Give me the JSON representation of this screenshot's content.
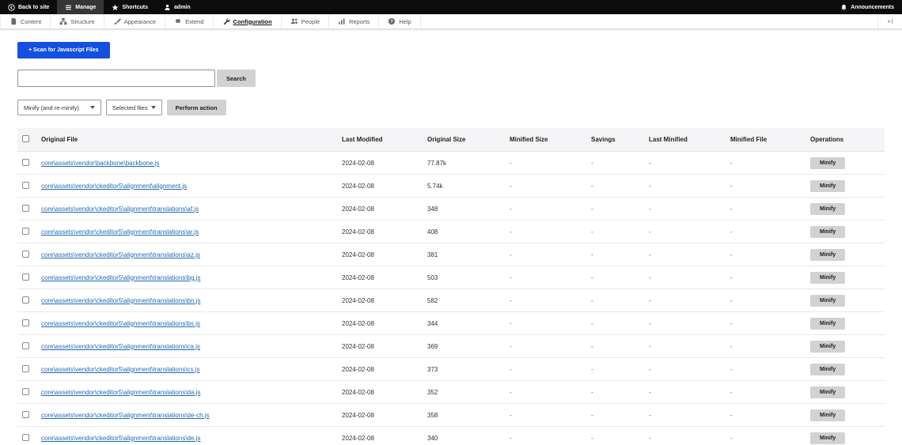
{
  "admin_bar": {
    "back_to_site": "Back to site",
    "manage": "Manage",
    "shortcuts": "Shortcuts",
    "user": "admin",
    "announcements": "Announcements"
  },
  "menu_bar": {
    "active": "Configuration",
    "items": [
      {
        "label": "Content",
        "icon": "file-icon"
      },
      {
        "label": "Structure",
        "icon": "sitemap-icon"
      },
      {
        "label": "Appearance",
        "icon": "brush-icon"
      },
      {
        "label": "Extend",
        "icon": "puzzle-icon"
      },
      {
        "label": "Configuration",
        "icon": "wrench-icon"
      },
      {
        "label": "People",
        "icon": "people-icon"
      },
      {
        "label": "Reports",
        "icon": "barchart-icon"
      },
      {
        "label": "Help",
        "icon": "help-icon"
      }
    ]
  },
  "actions": {
    "scan_button": "+ Scan for Javascript Files",
    "search_placeholder": "",
    "search_value": "",
    "search_button": "Search",
    "action_select": "Minify (and re-minify)",
    "files_dropdown": "Selected files",
    "perform_button": "Perform action"
  },
  "table": {
    "headers": [
      "Original File",
      "Last Modified",
      "Original Size",
      "Minified Size",
      "Savings",
      "Last Minified",
      "Minified File",
      "Operations"
    ],
    "operation_label": "Minify",
    "rows": [
      {
        "file": "core\\assets\\vendor\\backbone\\backbone.js",
        "last_modified": "2024-02-08",
        "original_size": "77.87k",
        "minified_size": "-",
        "savings": "-",
        "last_minified": "-",
        "minified_file": "-"
      },
      {
        "file": "core\\assets\\vendor\\ckeditor5\\alignment\\alignment.js",
        "last_modified": "2024-02-08",
        "original_size": "5.74k",
        "minified_size": "-",
        "savings": "-",
        "last_minified": "-",
        "minified_file": "-"
      },
      {
        "file": "core\\assets\\vendor\\ckeditor5\\alignment\\translations\\af.js",
        "last_modified": "2024-02-08",
        "original_size": "348",
        "minified_size": "-",
        "savings": "-",
        "last_minified": "-",
        "minified_file": "-"
      },
      {
        "file": "core\\assets\\vendor\\ckeditor5\\alignment\\translations\\ar.js",
        "last_modified": "2024-02-08",
        "original_size": "408",
        "minified_size": "-",
        "savings": "-",
        "last_minified": "-",
        "minified_file": "-"
      },
      {
        "file": "core\\assets\\vendor\\ckeditor5\\alignment\\translations\\az.js",
        "last_modified": "2024-02-08",
        "original_size": "381",
        "minified_size": "-",
        "savings": "-",
        "last_minified": "-",
        "minified_file": "-"
      },
      {
        "file": "core\\assets\\vendor\\ckeditor5\\alignment\\translations\\bg.js",
        "last_modified": "2024-02-08",
        "original_size": "503",
        "minified_size": "-",
        "savings": "-",
        "last_minified": "-",
        "minified_file": "-"
      },
      {
        "file": "core\\assets\\vendor\\ckeditor5\\alignment\\translations\\bn.js",
        "last_modified": "2024-02-08",
        "original_size": "582",
        "minified_size": "-",
        "savings": "-",
        "last_minified": "-",
        "minified_file": "-"
      },
      {
        "file": "core\\assets\\vendor\\ckeditor5\\alignment\\translations\\bs.js",
        "last_modified": "2024-02-08",
        "original_size": "344",
        "minified_size": "-",
        "savings": "-",
        "last_minified": "-",
        "minified_file": "-"
      },
      {
        "file": "core\\assets\\vendor\\ckeditor5\\alignment\\translations\\ca.js",
        "last_modified": "2024-02-08",
        "original_size": "369",
        "minified_size": "-",
        "savings": "-",
        "last_minified": "-",
        "minified_file": "-"
      },
      {
        "file": "core\\assets\\vendor\\ckeditor5\\alignment\\translations\\cs.js",
        "last_modified": "2024-02-08",
        "original_size": "373",
        "minified_size": "-",
        "savings": "-",
        "last_minified": "-",
        "minified_file": "-"
      },
      {
        "file": "core\\assets\\vendor\\ckeditor5\\alignment\\translations\\da.js",
        "last_modified": "2024-02-08",
        "original_size": "352",
        "minified_size": "-",
        "savings": "-",
        "last_minified": "-",
        "minified_file": "-"
      },
      {
        "file": "core\\assets\\vendor\\ckeditor5\\alignment\\translations\\de-ch.js",
        "last_modified": "2024-02-08",
        "original_size": "358",
        "minified_size": "-",
        "savings": "-",
        "last_minified": "-",
        "minified_file": "-"
      },
      {
        "file": "core\\assets\\vendor\\ckeditor5\\alignment\\translations\\de.js",
        "last_modified": "2024-02-08",
        "original_size": "340",
        "minified_size": "-",
        "savings": "-",
        "last_minified": "-",
        "minified_file": "-"
      }
    ]
  },
  "colors": {
    "primary_button": "#1450e0",
    "file_link": "#1f6bb5",
    "admin_bar_bg": "#0c0c0c",
    "gray_button": "#d2d2d2"
  }
}
